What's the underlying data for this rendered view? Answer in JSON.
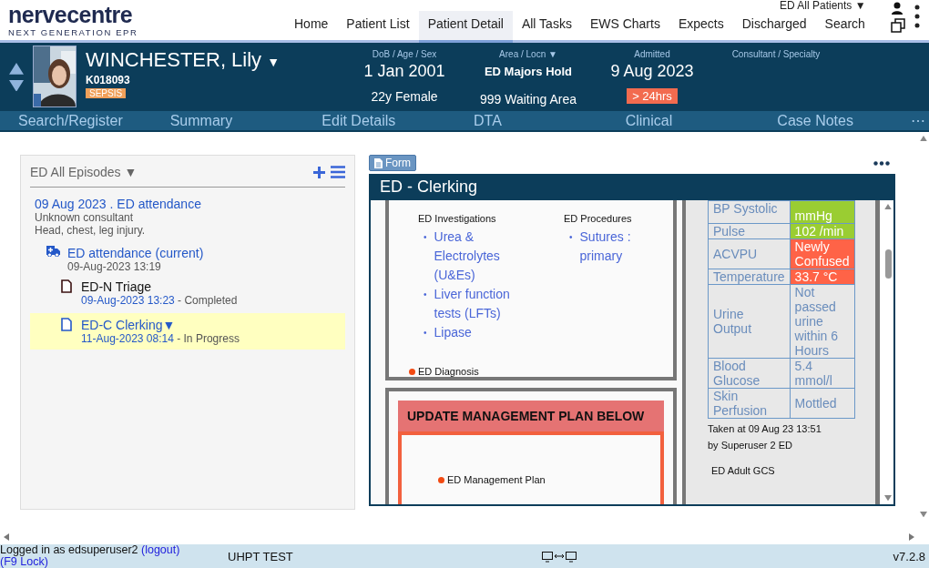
{
  "header": {
    "logo": "nervecentre",
    "tagline": "NEXT GENERATION EPR",
    "filter": "ED All Patients ▼",
    "nav": [
      {
        "label": "Home",
        "selected": false
      },
      {
        "label": "Patient List",
        "selected": false
      },
      {
        "label": "Patient Detail",
        "selected": true
      },
      {
        "label": "All Tasks",
        "selected": false
      },
      {
        "label": "EWS Charts",
        "selected": false
      },
      {
        "label": "Expects",
        "selected": false
      },
      {
        "label": "Discharged",
        "selected": false
      },
      {
        "label": "Search",
        "selected": false
      }
    ]
  },
  "patient": {
    "name": "WINCHESTER, Lily",
    "name_caret": "▼",
    "id": "K018093",
    "alert": "SEPSIS",
    "fields": [
      {
        "label": "DoB / Age / Sex",
        "value": "1 Jan 2001",
        "detail": "22y Female"
      },
      {
        "label": "Area / Locn ▼",
        "value": "ED Majors Hold",
        "detail": "999 Waiting Area"
      },
      {
        "label": "Admitted",
        "value": "9 Aug 2023",
        "badge": "> 24hrs"
      },
      {
        "label": "Consultant / Specialty"
      }
    ]
  },
  "subnav": {
    "items": [
      "Search/Register",
      "Summary",
      "Edit Details",
      "DTA",
      "Clinical",
      "Case Notes"
    ],
    "more": "⋯"
  },
  "episodes": {
    "filter": "ED All Episodes ▼",
    "episode": {
      "title": "09 Aug 2023 . ED attendance",
      "consultant": "Unknown consultant",
      "complaint": "Head, chest, leg injury."
    },
    "attendance": {
      "title": "ED attendance (current)",
      "time": "09-Aug-2023 13:19"
    },
    "documents": [
      {
        "title": "ED-N Triage",
        "time": "09-Aug-2023 13:23",
        "status": "- Completed",
        "selected": false
      },
      {
        "title": "ED-C Clerking▼",
        "time": "11-Aug-2023 08:14",
        "status": "- In Progress",
        "selected": true
      }
    ]
  },
  "form": {
    "button": "Form",
    "title": "ED - Clerking",
    "bullet": "•",
    "investigations": {
      "heading": "ED Investigations",
      "items": [
        "Urea & Electrolytes (U&Es)",
        "Liver function tests (LFTs)",
        "Lipase"
      ]
    },
    "procedures": {
      "heading": "ED Procedures",
      "items": [
        "Sutures : primary"
      ]
    },
    "diagnosis": "ED Diagnosis",
    "plan_heading": "UPDATE MANAGEMENT PLAN BELOW",
    "plan_field": "ED Management Plan",
    "vitals": [
      {
        "label": "BP Systolic",
        "value": "mmHg",
        "color": "#9acd32"
      },
      {
        "label": "Pulse",
        "value": "102 /min",
        "color": "#9acd32"
      },
      {
        "label": "ACVPU",
        "value": "Newly Confused",
        "color": "#ff6347"
      },
      {
        "label": "Temperature",
        "value": "33.7 °C",
        "color": "#ff6347"
      },
      {
        "label": "Urine Output",
        "value": "Not passed urine within 6 Hours"
      },
      {
        "label": "Blood Glucose",
        "value": "5.4 mmol/l"
      },
      {
        "label": "Skin Perfusion",
        "value": "Mottled"
      }
    ],
    "taken": "Taken at 09 Aug 23 13:51",
    "by": "by Superuser 2 ED",
    "gcs": "ED Adult GCS"
  },
  "status_bar": {
    "user": "Logged in as edsuperuser2",
    "logout": "(logout)",
    "lock": "(F9 Lock)",
    "env": "UHPT TEST",
    "version": "v7.2.8"
  }
}
